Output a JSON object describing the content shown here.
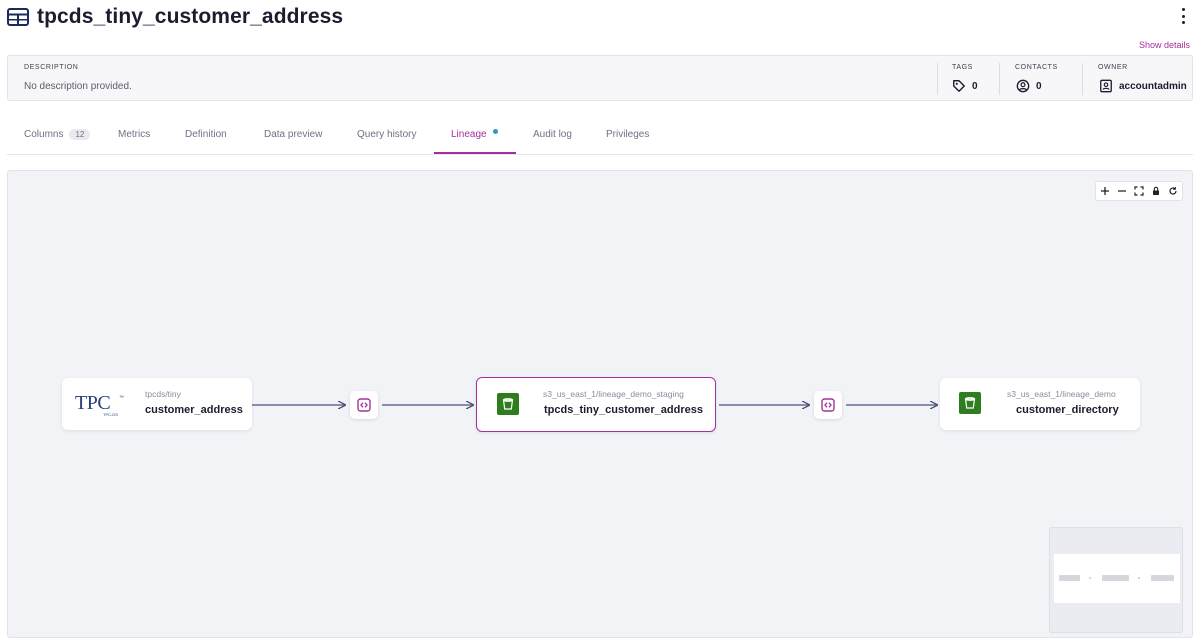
{
  "header": {
    "title": "tpcds_tiny_customer_address",
    "show_details": "Show details"
  },
  "info": {
    "description_label": "DESCRIPTION",
    "description_value": "No description provided.",
    "tags_label": "TAGS",
    "tags_count": "0",
    "contacts_label": "CONTACTS",
    "contacts_count": "0",
    "owner_label": "OWNER",
    "owner_value": "accountadmin"
  },
  "tabs": [
    {
      "label": "Columns",
      "count": "12"
    },
    {
      "label": "Metrics"
    },
    {
      "label": "Definition"
    },
    {
      "label": "Data preview"
    },
    {
      "label": "Query history"
    },
    {
      "label": "Lineage",
      "active": true
    },
    {
      "label": "Audit log"
    },
    {
      "label": "Privileges"
    }
  ],
  "lineage": {
    "nodes": [
      {
        "namespace": "tpcds/tiny",
        "name": "customer_address",
        "logo": "tpc-logo"
      },
      {
        "namespace": "s3_us_east_1/lineage_demo_staging",
        "name": "tpcds_tiny_customer_address",
        "logo": "s3-bucket-icon",
        "selected": true
      },
      {
        "namespace": "s3_us_east_1/lineage_demo",
        "name": "customer_directory",
        "logo": "s3-bucket-icon"
      }
    ],
    "tpc_logo": {
      "text": "TPC",
      "tm": "™",
      "sub": "TPC-DS"
    },
    "controls": [
      "zoom-in-icon",
      "zoom-out-icon",
      "fit-view-icon",
      "lock-icon",
      "refresh-icon"
    ]
  },
  "colors": {
    "accent": "#a5309c",
    "edge": "#4a5278",
    "bucket": "#2e7d1f",
    "canvas": "#f2f3f7"
  }
}
